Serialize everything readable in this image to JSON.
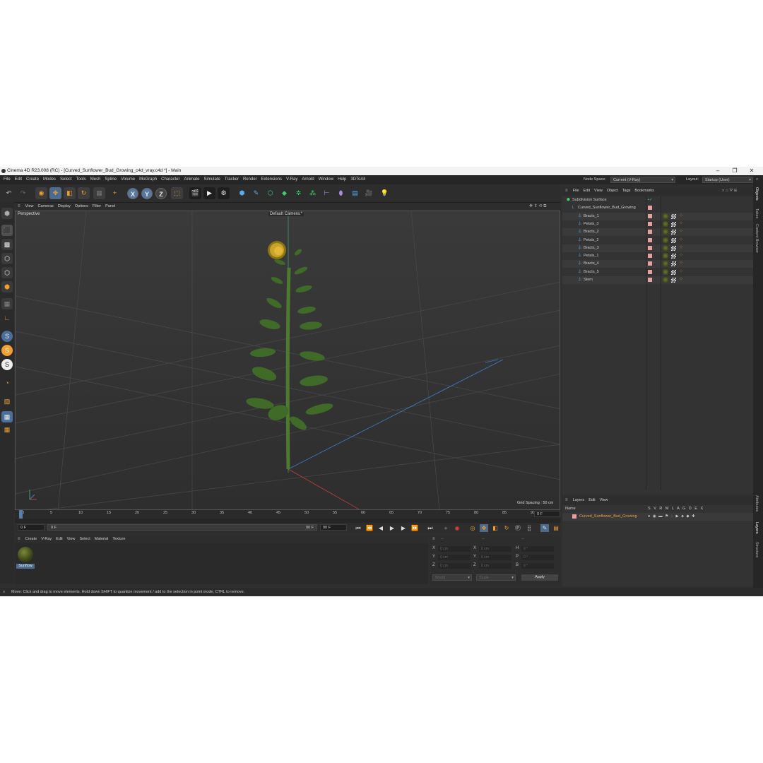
{
  "window": {
    "title": "Cinema 4D R23.008 (RC) - [Curved_Sunflower_Bud_Growing_c4d_vray.c4d *] - Main",
    "minimize": "–",
    "maximize": "❐",
    "close": "✕"
  },
  "menubar": {
    "items": [
      "File",
      "Edit",
      "Create",
      "Modes",
      "Select",
      "Tools",
      "Mesh",
      "Spline",
      "Volume",
      "MoGraph",
      "Character",
      "Animate",
      "Simulate",
      "Tracker",
      "Render",
      "Extensions",
      "V-Ray",
      "Arnold",
      "Window",
      "Help",
      "3DToAll"
    ],
    "node_space_label": "Node Space:",
    "node_space_value": "Current (V-Ray)",
    "layout_label": "Layout:",
    "layout_value": "Startup (User)"
  },
  "toolbar": {
    "axis_x": "X",
    "axis_y": "Y",
    "axis_z": "Z"
  },
  "viewport": {
    "menu": [
      "View",
      "Cameras",
      "Display",
      "Options",
      "Filter",
      "Panel"
    ],
    "mode_label": "Perspective",
    "camera_label": "Default Camera",
    "camera_suffix": ":*",
    "grid_spacing": "Grid Spacing : 50 cm"
  },
  "timeline": {
    "ticks": [
      "0",
      "5",
      "10",
      "15",
      "20",
      "25",
      "30",
      "35",
      "40",
      "45",
      "50",
      "55",
      "60",
      "65",
      "70",
      "75",
      "80",
      "85",
      "90"
    ],
    "current_frame": "0 F",
    "start_frame": "0 F",
    "range_start": "0 F",
    "range_end": "90 F",
    "end_frame": "90 F"
  },
  "material_manager": {
    "menu": [
      "Create",
      "V-Ray",
      "Edit",
      "View",
      "Select",
      "Material",
      "Texture"
    ],
    "material_name": "Sunflow"
  },
  "coordinates": {
    "rows": [
      {
        "pos_axis": "X",
        "pos_value": "0 cm",
        "size_axis": "X",
        "size_value": "0 cm",
        "rot_axis": "H",
        "rot_value": "0 °"
      },
      {
        "pos_axis": "Y",
        "pos_value": "0 cm",
        "size_axis": "Y",
        "size_value": "0 cm",
        "rot_axis": "P",
        "rot_value": "0 °"
      },
      {
        "pos_axis": "Z",
        "pos_value": "0 cm",
        "size_axis": "Z",
        "size_value": "0 cm",
        "rot_axis": "B",
        "rot_value": "0 °"
      }
    ],
    "space": "World",
    "mode": "Scale",
    "apply": "Apply",
    "header_dashes": "--"
  },
  "object_manager": {
    "menu": [
      "File",
      "Edit",
      "View",
      "Object",
      "Tags",
      "Bookmarks"
    ],
    "objects": [
      {
        "name": "Subdivision Surface",
        "level": 0
      },
      {
        "name": "Curved_Sunflower_Bud_Growing",
        "level": 1
      },
      {
        "name": "Bracts_1",
        "level": 2
      },
      {
        "name": "Petals_3",
        "level": 2
      },
      {
        "name": "Bracts_2",
        "level": 2
      },
      {
        "name": "Petals_2",
        "level": 2
      },
      {
        "name": "Bracts_3",
        "level": 2
      },
      {
        "name": "Petals_1",
        "level": 2
      },
      {
        "name": "Bracts_4",
        "level": 2
      },
      {
        "name": "Bracts_5",
        "level": 2
      },
      {
        "name": "Stem",
        "level": 2
      }
    ]
  },
  "layers": {
    "menu": [
      "Layers",
      "Edit",
      "View"
    ],
    "name_header": "Name",
    "columns": "S V R M L A G D E X",
    "layer_name": "Curved_Sunflower_Bud_Growing"
  },
  "side_tabs": [
    "Objects",
    "Takes",
    "Content Browser",
    "Attributes",
    "Layers",
    "Structure"
  ],
  "status": {
    "text": "Move: Click and drag to move elements. Hold down SHIFT to quantize movement / add to the selection in point mode, CTRL to remove."
  },
  "colors": {
    "accent": "#5b7fa8",
    "layer_orange": "#e8a040",
    "swatch_pink": "#e6a0a0"
  }
}
